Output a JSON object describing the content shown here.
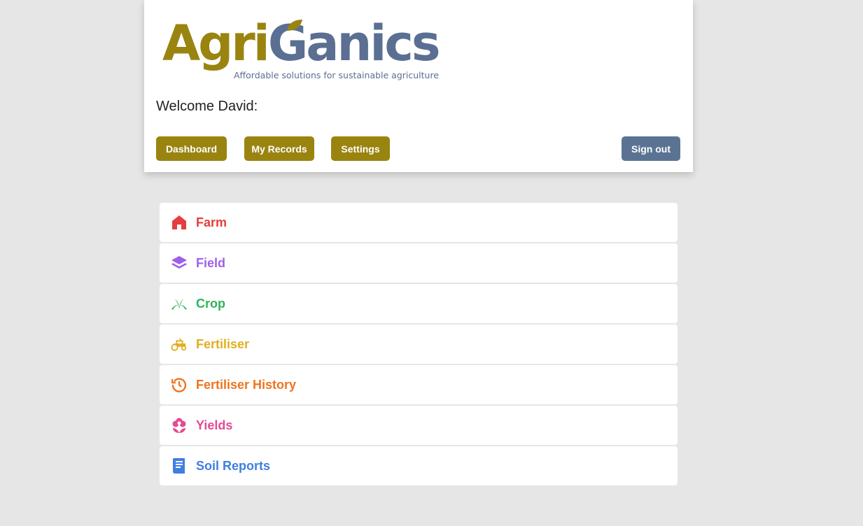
{
  "logo": {
    "word_part1": "Agri",
    "word_part2": "Ganics",
    "tagline": "Affordable solutions for sustainable agriculture"
  },
  "welcome": "Welcome David:",
  "nav": {
    "dashboard": "Dashboard",
    "my_records": "My Records",
    "settings": "Settings",
    "sign_out": "Sign out"
  },
  "menu": [
    {
      "label": "Farm",
      "icon": "house-icon",
      "color": "#e53e3e"
    },
    {
      "label": "Field",
      "icon": "layers-icon",
      "color": "#9f5fe8"
    },
    {
      "label": "Crop",
      "icon": "seedling-icon",
      "color": "#2fb45a"
    },
    {
      "label": "Fertiliser",
      "icon": "tractor-icon",
      "color": "#e0b020"
    },
    {
      "label": "Fertiliser History",
      "icon": "history-icon",
      "color": "#ee7420"
    },
    {
      "label": "Yields",
      "icon": "flower-icon",
      "color": "#e34a92"
    },
    {
      "label": "Soil Reports",
      "icon": "report-icon",
      "color": "#3f7fe0"
    }
  ],
  "colors": {
    "brand_gold": "#9a8410",
    "brand_slate": "#5b7393",
    "background": "#e6e6e6"
  }
}
